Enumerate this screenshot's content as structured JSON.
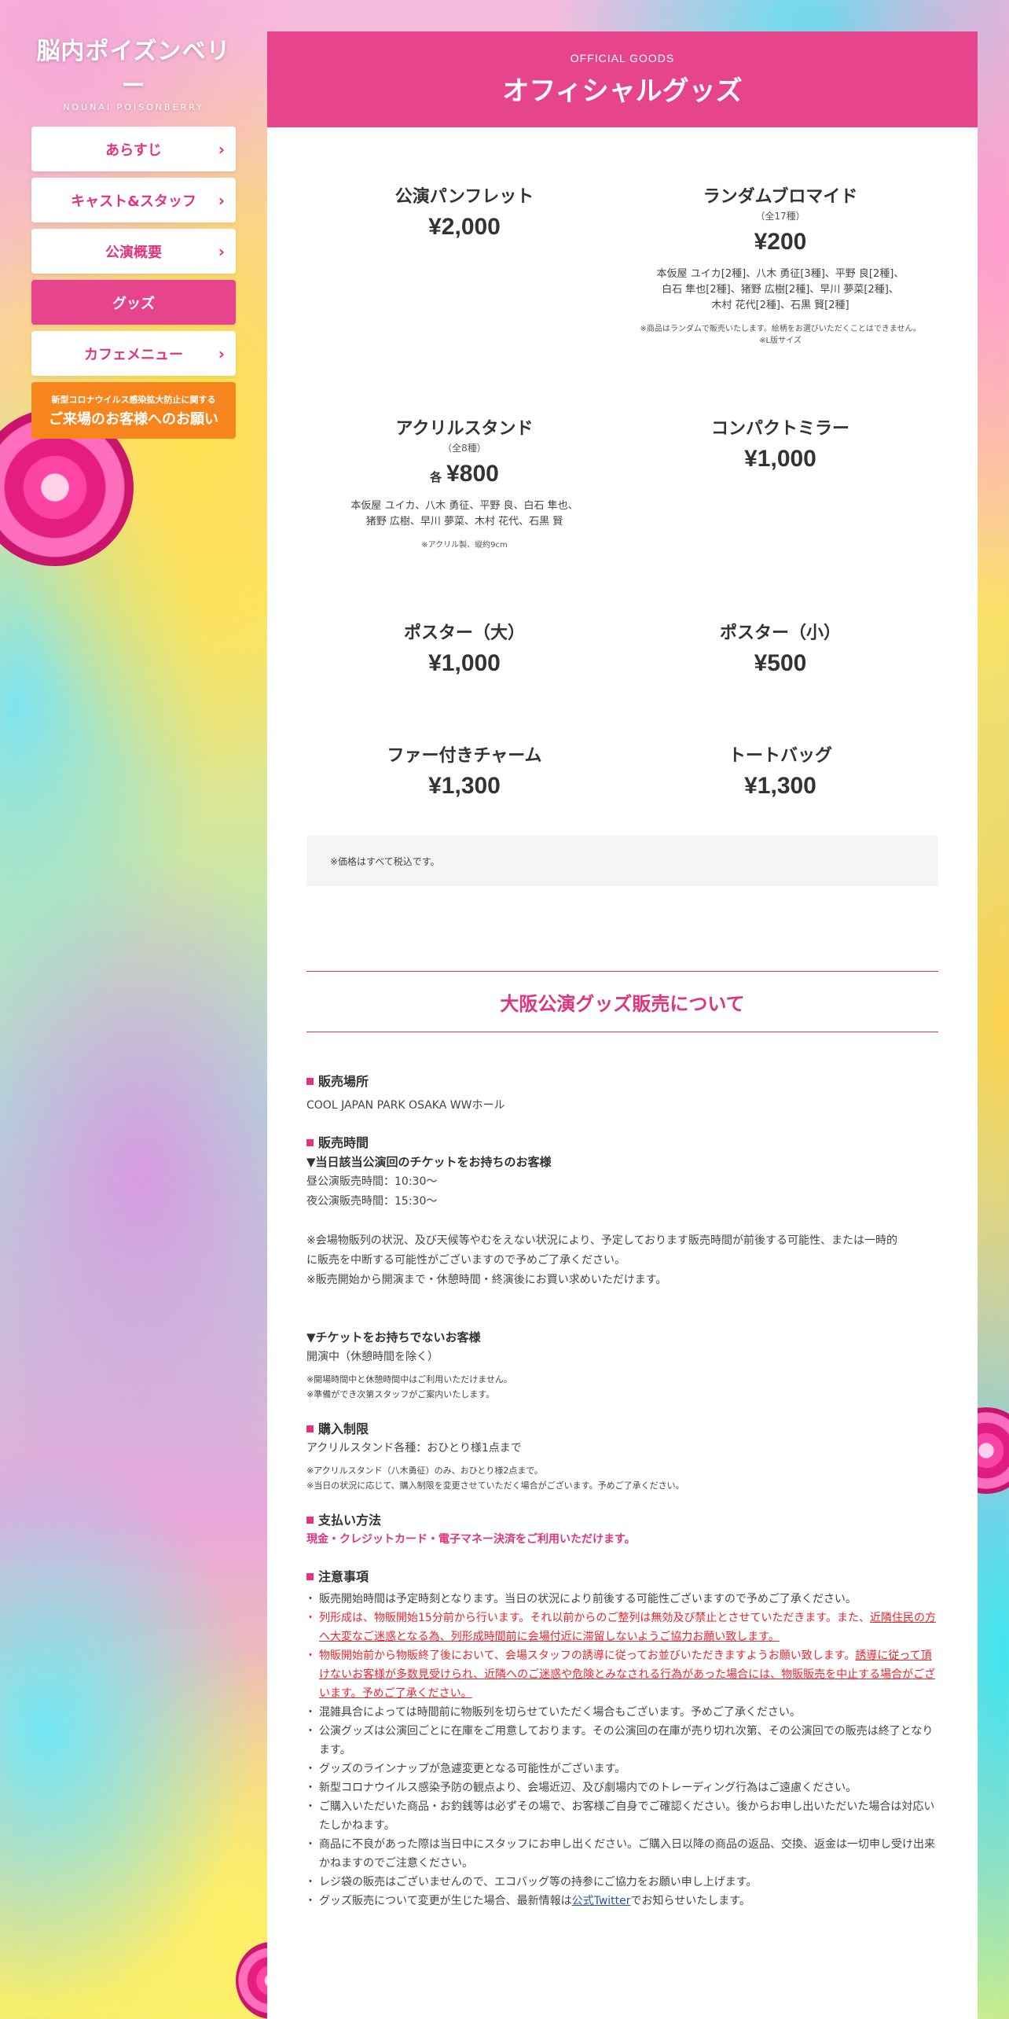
{
  "logo": {
    "main": "脳内ポイズンベリー",
    "sub": "NOUNAI POISONBERRY"
  },
  "nav": {
    "items": [
      {
        "label": "あらすじ"
      },
      {
        "label": "キャスト&スタッフ"
      },
      {
        "label": "公演概要"
      },
      {
        "label": "グッズ"
      },
      {
        "label": "カフェメニュー"
      }
    ],
    "chevron": "›",
    "corona": {
      "small": "新型コロナウイルス感染拡大防止に関する",
      "large": "ご来場のお客様へのお願い"
    }
  },
  "header": {
    "en": "OFFICIAL GOODS",
    "ja": "オフィシャルグッズ"
  },
  "goods": [
    {
      "name": "公演パンフレット",
      "price": "¥2,000"
    },
    {
      "name": "ランダムブロマイド",
      "sub": "（全17種）",
      "price": "¥200",
      "desc1": "本仮屋 ユイカ[2種]、八木 勇征[3種]、平野 良[2種]、",
      "desc2": "白石 隼也[2種]、猪野 広樹[2種]、早川 夢菜[2種]、",
      "desc3": "木村 花代[2種]、石黒 賢[2種]",
      "note1": "※商品はランダムで販売いたします。絵柄をお選びいただくことはできません。",
      "note2": "※L版サイズ"
    },
    {
      "name": "アクリルスタンド",
      "sub": "（全8種）",
      "each": "各",
      "price": "¥800",
      "desc1": "本仮屋 ユイカ、八木 勇征、平野 良、白石 隼也、",
      "desc2": "猪野 広樹、早川 夢菜、木村 花代、石黒 賢",
      "note1": "※アクリル製、縦約9cm"
    },
    {
      "name": "コンパクトミラー",
      "price": "¥1,000"
    },
    {
      "name": "ポスター（大）",
      "price": "¥1,000"
    },
    {
      "name": "ポスター（小）",
      "price": "¥500"
    },
    {
      "name": "ファー付きチャーム",
      "price": "¥1,300"
    },
    {
      "name": "トートバッグ",
      "price": "¥1,300"
    }
  ],
  "tax_note": "※価格はすべて税込です。",
  "osaka": {
    "title": "大阪公演グッズ販売について",
    "place_h": "販売場所",
    "place": "COOL JAPAN PARK OSAKA WWホール",
    "time_h": "販売時間",
    "ticket_h": "▼当日該当公演回のチケットをお持ちのお客様",
    "matinee": "昼公演販売時間：10:30〜",
    "soiree": "夜公演販売時間：15:30〜",
    "time_note1": "※会場物販列の状況、及び天候等やむをえない状況により、予定しております販売時間が前後する可能性、または一時的",
    "time_note2": "に販売を中断する可能性がございますので予めご了承ください。",
    "time_note3": "※販売開始から開演まで・休憩時間・終演後にお買い求めいただけます。",
    "noticket_h": "▼チケットをお持ちでないお客様",
    "noticket": "開演中（休憩時間を除く）",
    "noticket_note1": "※開場時間中と休憩時間中はご利用いただけません。",
    "noticket_note2": "※準備ができ次第スタッフがご案内いたします。",
    "limit_h": "購入制限",
    "limit": "アクリルスタンド各種：おひとり様1点まで",
    "limit_note1": "※アクリルスタンド（八木勇征）のみ、おひとり様2点まで。",
    "limit_note2": "※当日の状況に応じて、購入制限を変更させていただく場合がございます。予めご了承ください。",
    "pay_h": "支払い方法",
    "pay": "現金・クレジットカード・電子マネー決済をご利用いただけます。",
    "caution_h": "注意事項",
    "n1": "販売開始時間は予定時刻となります。当日の状況により前後する可能性ございますので予めご了承ください。",
    "n2a": "列形成は、物販開始15分前から行います。それ以前からのご整列は無効及び禁止とさせていただきます。また、",
    "n2b": "近隣住民の方",
    "n2c": "へ大変なご迷惑となる為、列形成時間前に会場付近に滞留しないようご協力お願い致します。",
    "n3a": "物販開始前から物販終了後において、会場スタッフの誘導に従ってお並びいただきますようお願い致します。",
    "n3b": "誘導に従って頂けないお客様が多数見受けられ、近隣へのご迷惑や危険とみなされる行為があった場合には、物販販売を中止する場合がございます。予めご了承ください。",
    "n4": "混雑具合によっては時間前に物販列を切らせていただく場合もございます。予めご了承ください。",
    "n5": "公演グッズは公演回ごとに在庫をご用意しております。その公演回の在庫が売り切れ次第、その公演回での販売は終了となります。",
    "n6": "グッズのラインナップが急遽変更となる可能性がございます。",
    "n7": "新型コロナウイルス感染予防の観点より、会場近辺、及び劇場内でのトレーディング行為はご遠慮ください。",
    "n8": "ご購入いただいた商品・お釣銭等は必ずその場で、お客様ご自身でご確認ください。後からお申し出いただいた場合は対応いたしかねます。",
    "n9": "商品に不良があった際は当日中にスタッフにお申し出ください。ご購入日以降の商品の返品、交換、返金は一切申し受け出来かねますのでご注意ください。",
    "n10": "レジ袋の販売はございませんので、エコバッグ等の持参にご協力をお願い申し上げます。",
    "n11a": "グッズ販売について変更が生じた場合、最新情報は",
    "n11link": "公式Twitter",
    "n11b": "でお知らせいたします。"
  }
}
